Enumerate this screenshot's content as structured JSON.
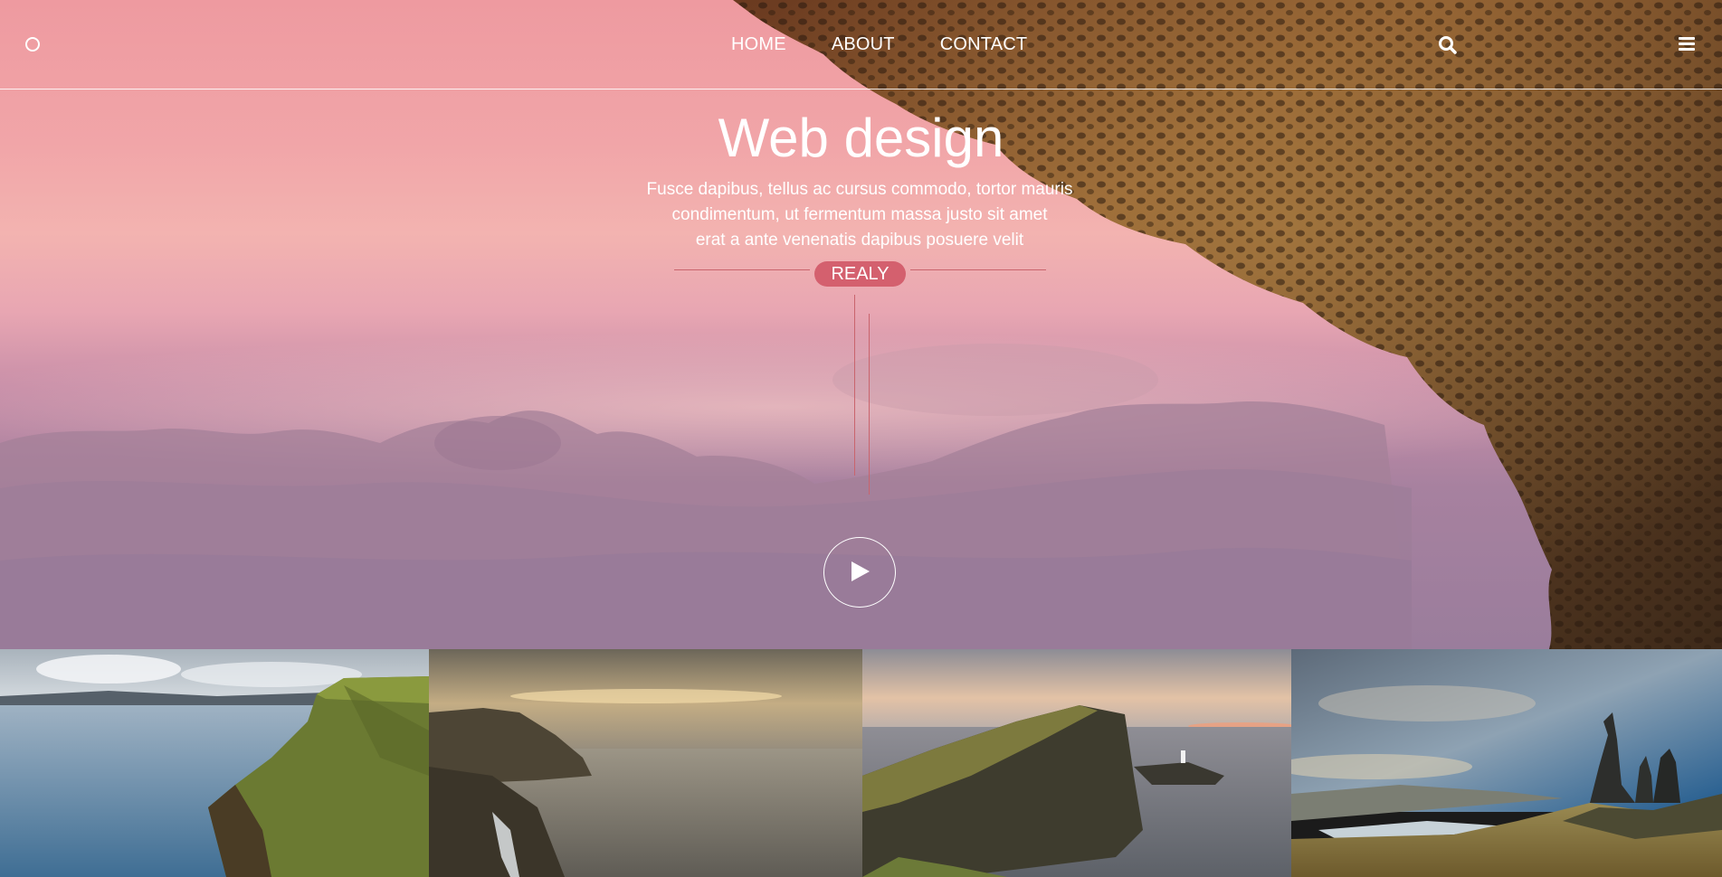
{
  "nav": {
    "items": [
      {
        "label": "HOME"
      },
      {
        "label": "ABOUT"
      },
      {
        "label": "CONTACT"
      }
    ],
    "logo_icon": "circle-logo-icon",
    "search_icon": "search-icon",
    "menu_icon": "hamburger-menu-icon"
  },
  "hero": {
    "title": "Web design",
    "subtitle_lines": [
      "Fusce dapibus, tellus ac cursus commodo, tortor mauris",
      "condimentum, ut fermentum massa justo sit amet",
      "erat a ante venenatis dapibus posuere velit"
    ],
    "button_label": "REALY",
    "play_icon": "play-icon",
    "accent_color": "#d4606e"
  },
  "gallery": {
    "images": [
      {
        "alt_icon": "coastal-cliff-image"
      },
      {
        "alt_icon": "sea-cliff-sunset-image"
      },
      {
        "alt_icon": "lighthouse-headland-image"
      },
      {
        "alt_icon": "rock-pinnacles-image"
      }
    ]
  }
}
